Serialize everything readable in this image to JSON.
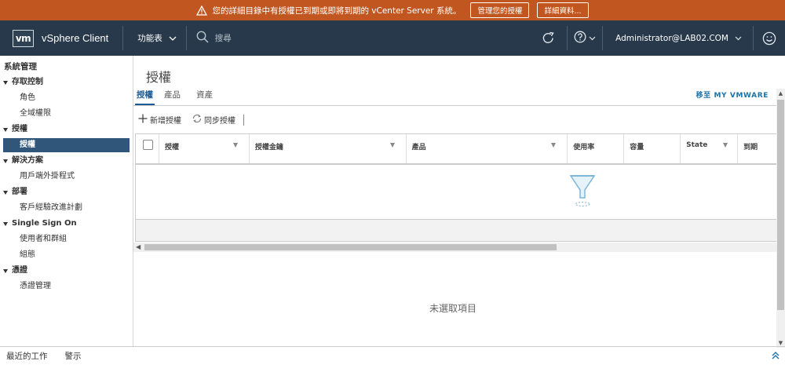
{
  "banner": {
    "message": "您的詳細目錄中有授權已到期或即將到期的 vCenter Server 系統。",
    "btn_manage": "管理您的授權",
    "btn_details": "詳細資料..."
  },
  "header": {
    "logo": "vm",
    "app_title": "vSphere Client",
    "menu_label": "功能表",
    "search_placeholder": "搜尋",
    "user": "Administrator@LAB02.COM"
  },
  "sidebar": {
    "title": "系統管理",
    "sections": [
      {
        "label": "存取控制",
        "items": [
          "角色",
          "全域權限"
        ]
      },
      {
        "label": "授權",
        "items": [
          "授權"
        ]
      },
      {
        "label": "解決方案",
        "items": [
          "用戶端外掛程式"
        ]
      },
      {
        "label": "部署",
        "items": [
          "客戶經驗改進計劃"
        ]
      },
      {
        "label": "Single Sign On",
        "items": [
          "使用者和群組",
          "組態"
        ]
      },
      {
        "label": "憑證",
        "items": [
          "憑證管理"
        ]
      }
    ]
  },
  "page": {
    "title": "授權",
    "tabs": [
      "授權",
      "產品",
      "資產"
    ],
    "goto_link": "移至 MY VMWARE",
    "toolbar": {
      "add": "新增授權",
      "sync": "同步授權"
    },
    "columns": [
      "授權",
      "授權金鑰",
      "產品",
      "使用率",
      "容量",
      "State",
      "到期"
    ],
    "no_selection": "未選取項目"
  },
  "bottom": {
    "recent_tasks": "最近的工作",
    "alarms": "警示"
  },
  "colors": {
    "banner": "#c25620",
    "header": "#27394a",
    "selected": "#305679",
    "link": "#1a72a8"
  }
}
